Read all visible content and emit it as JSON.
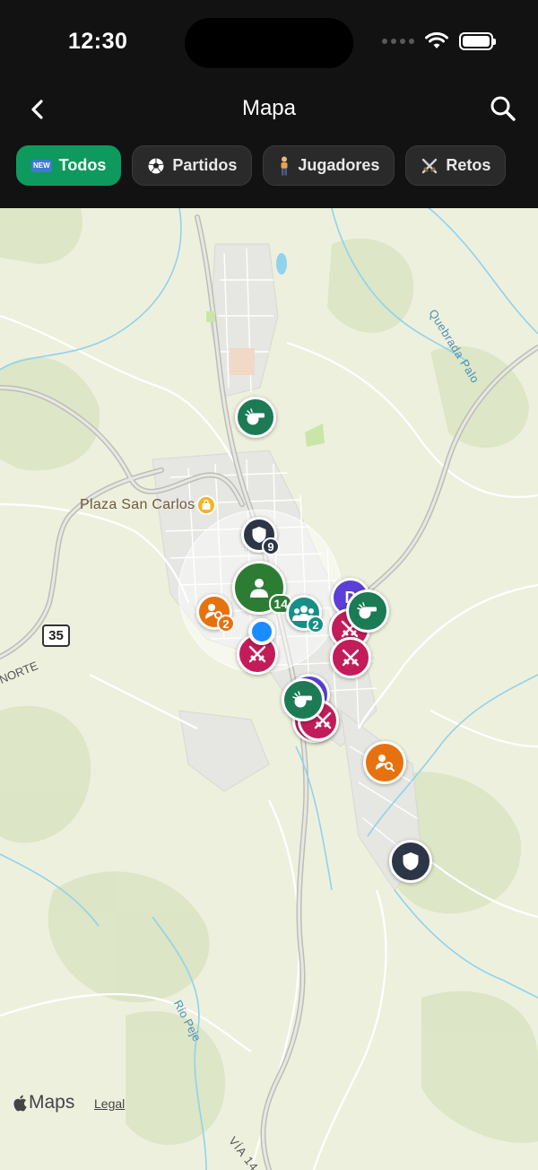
{
  "status_bar": {
    "time": "12:30"
  },
  "nav": {
    "title": "Mapa"
  },
  "filters": [
    {
      "label": "Todos",
      "icon": "new-badge",
      "badge": "NEW",
      "active": true
    },
    {
      "label": "Partidos",
      "icon": "soccer-ball",
      "active": false
    },
    {
      "label": "Jugadores",
      "icon": "person",
      "active": false
    },
    {
      "label": "Retos",
      "icon": "crossed-swords",
      "active": false
    }
  ],
  "map": {
    "place_name": "Plaza San Carlos",
    "road_number": "35",
    "road_label_left": "NORTE",
    "river_label_1": "Quebrada Palo",
    "river_label_2": "Río Peje",
    "road_label_bottom": "VÍA 14",
    "brand": "Maps",
    "legal": "Legal",
    "pins": [
      {
        "type": "referee-whistle",
        "color": "#1c7a55"
      },
      {
        "type": "shield-team",
        "color": "#2d3647",
        "count": "9"
      },
      {
        "type": "players-cluster",
        "color": "#2c7d33",
        "count": "14"
      },
      {
        "type": "player-search",
        "color": "#e6720f",
        "count": "2"
      },
      {
        "type": "group",
        "color": "#168f86",
        "count": "2"
      },
      {
        "type": "challenge",
        "color": "#c31c5a"
      },
      {
        "type": "challenge",
        "color": "#c31c5a"
      },
      {
        "type": "challenge",
        "color": "#c31c5a"
      },
      {
        "type": "referee-whistle",
        "color": "#1c7a55"
      },
      {
        "type": "referee-whistle",
        "color": "#1c7a55"
      },
      {
        "type": "challenge",
        "color": "#c31c5a"
      },
      {
        "type": "player-search",
        "color": "#e6720f"
      },
      {
        "type": "shield-team",
        "color": "#2d3647"
      }
    ]
  }
}
